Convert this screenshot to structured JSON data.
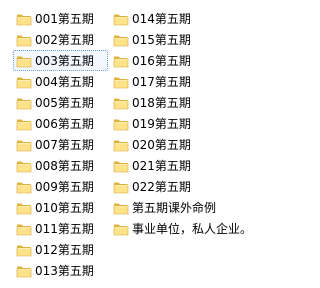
{
  "window": {
    "title": ""
  },
  "icons": {
    "folder": "folder-icon",
    "folder_color_light": "#FFE38A",
    "folder_color_dark": "#E2B33A"
  },
  "files": {
    "column1": [
      {
        "label": "001第五期"
      },
      {
        "label": "002第五期"
      },
      {
        "label": "003第五期"
      },
      {
        "label": "004第五期"
      },
      {
        "label": "005第五期"
      },
      {
        "label": "006第五期"
      },
      {
        "label": "007第五期"
      },
      {
        "label": "008第五期"
      },
      {
        "label": "009第五期"
      },
      {
        "label": "010第五期"
      },
      {
        "label": "011第五期"
      },
      {
        "label": "012第五期"
      },
      {
        "label": "013第五期"
      }
    ],
    "column2": [
      {
        "label": "014第五期"
      },
      {
        "label": "015第五期"
      },
      {
        "label": "016第五期"
      },
      {
        "label": "017第五期"
      },
      {
        "label": "018第五期"
      },
      {
        "label": "019第五期"
      },
      {
        "label": "020第五期"
      },
      {
        "label": "021第五期"
      },
      {
        "label": "022第五期"
      },
      {
        "label": "第五期课外命例"
      },
      {
        "label": "事业单位，私人企业。"
      }
    ],
    "focused_item": "003第五期"
  }
}
